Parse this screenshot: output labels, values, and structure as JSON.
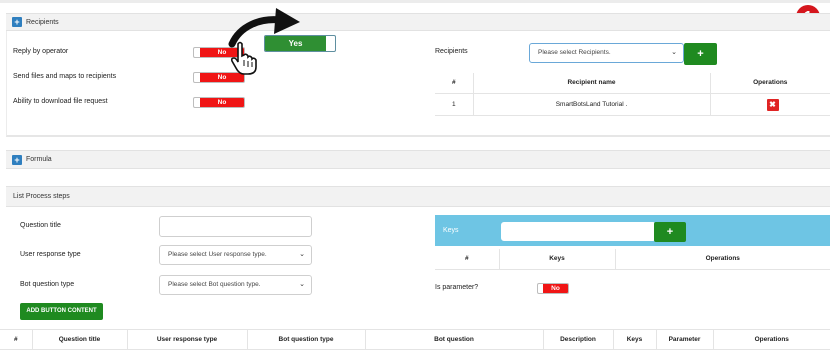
{
  "badge": "1",
  "recipients_panel": {
    "title": "Recipients",
    "settings": [
      {
        "label": "Reply by operator",
        "value": "No"
      },
      {
        "label": "Send files and maps to recipients",
        "value": "No"
      },
      {
        "label": "Ability to download file request",
        "value": "No"
      }
    ],
    "callout_toggle": "Yes",
    "recipients_label": "Recipients",
    "recipients_select": "Please select Recipients.",
    "add_label": "+",
    "table": {
      "headers": [
        "#",
        "Recipient name",
        "Operations"
      ],
      "rows": [
        {
          "num": "1",
          "name": "SmartBotsLand Tutorial .",
          "op": "✖"
        }
      ]
    }
  },
  "formula_panel": {
    "title": "Formula"
  },
  "process_panel": {
    "title": "List Process steps",
    "question_title_label": "Question title",
    "user_response_label": "User response type",
    "user_response_select": "Please select User response type.",
    "bot_question_label": "Bot question type",
    "bot_question_select": "Please select Bot question type.",
    "add_button_content": "ADD BUTTON CONTENT",
    "keys_label": "Keys",
    "keys_add": "+",
    "keys_table_headers": [
      "#",
      "Keys",
      "Operations"
    ],
    "is_parameter_label": "Is parameter?",
    "is_parameter_value": "No",
    "steps_table_headers": [
      "#",
      "Question title",
      "User response type",
      "Bot question type",
      "Bot question",
      "Description",
      "Keys",
      "Parameter",
      "Operations"
    ]
  },
  "colors": {
    "accent_green": "#1f8a20",
    "danger_red": "#f01515",
    "keys_blue": "#6ec5e4",
    "badge_red": "#d5161d"
  },
  "icons": [
    "plus-square-icon",
    "delete-x-icon",
    "pointer-hand-icon",
    "curved-arrow-icon",
    "chevron-down-icon"
  ]
}
